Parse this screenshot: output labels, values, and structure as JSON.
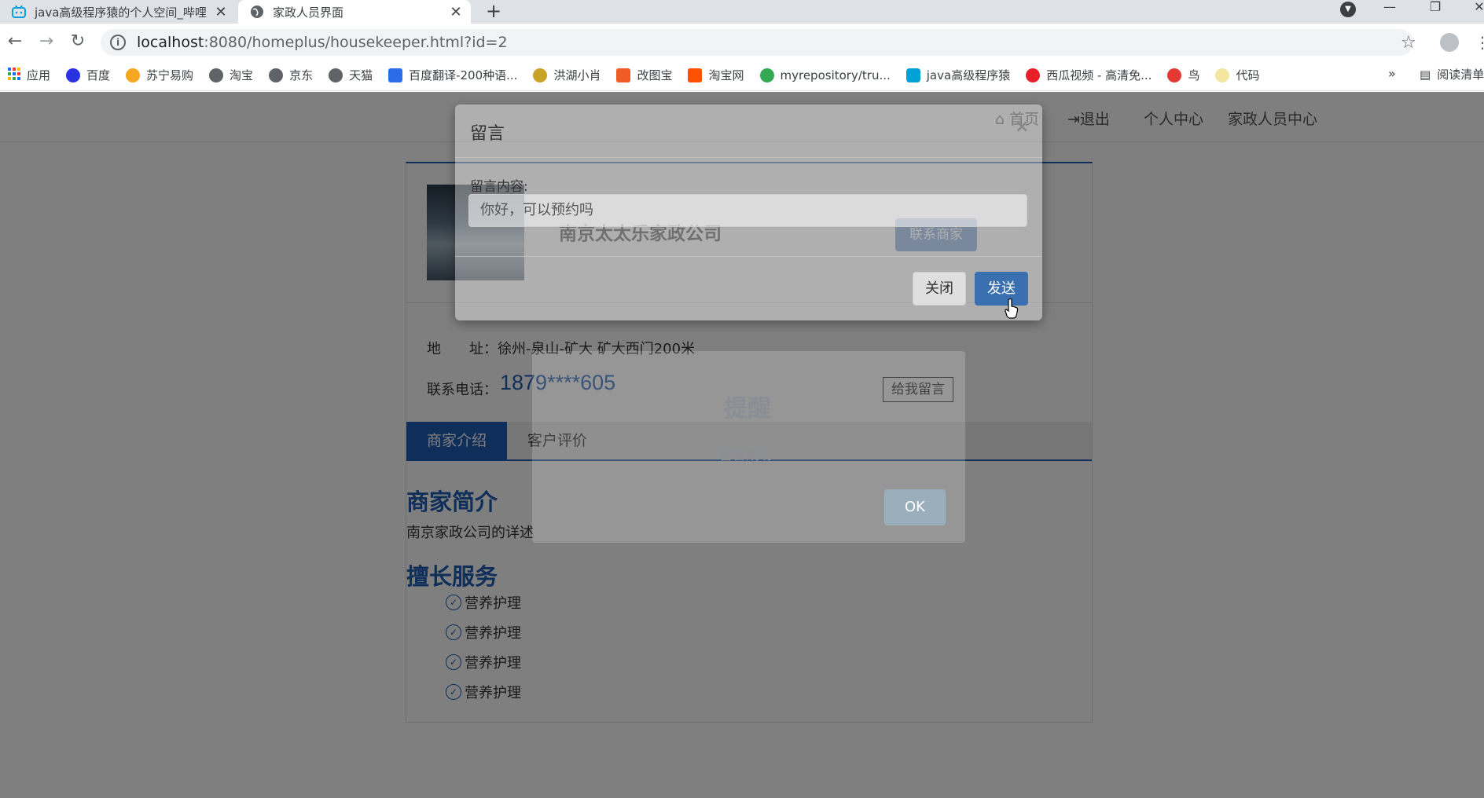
{
  "browser": {
    "tabs": [
      {
        "title": "java高级程序猿的个人空间_哔哩",
        "active": false
      },
      {
        "title": "家政人员界面",
        "active": true
      }
    ],
    "url_host": "localhost",
    "url_path": ":8080/homeplus/housekeeper.html?id=2",
    "bookmarks": [
      "应用",
      "百度",
      "苏宁易购",
      "淘宝",
      "京东",
      "天猫",
      "百度翻译-200种语...",
      "洪湖小肖",
      "改图宝",
      "淘宝网",
      "myrepository/tru...",
      "java高级程序猿",
      "西瓜视频 - 高清免...",
      "鸟",
      "代码"
    ],
    "bookmarks_more": "»",
    "reading_list": "阅读清单"
  },
  "nav": {
    "home": "首页",
    "logout": "退出",
    "personal": "个人中心",
    "housekeeper_center": "家政人员中心"
  },
  "shop": {
    "name": "南京太太乐家政公司",
    "contact_button": "联系商家",
    "address_label": "地　　址：",
    "address": "徐州-泉山-矿大 矿大西门200米",
    "phone_label": "联系电话：",
    "phone": "1879****605",
    "message_button": "给我留言"
  },
  "tabs": {
    "intro": "商家介绍",
    "reviews": "客户评价"
  },
  "intro": {
    "title": "商家简介",
    "text": "南京家政公司的详述",
    "services_title": "擅长服务",
    "services": [
      "营养护理",
      "营养护理",
      "营养护理",
      "营养护理"
    ]
  },
  "alert": {
    "title": "提醒",
    "message": "留言成功",
    "ok": "OK"
  },
  "modal": {
    "title": "留言",
    "close_x": "×",
    "label": "留言内容:",
    "input_value": "你好，可以预约吗",
    "close_button": "关闭",
    "send_button": "发送"
  }
}
